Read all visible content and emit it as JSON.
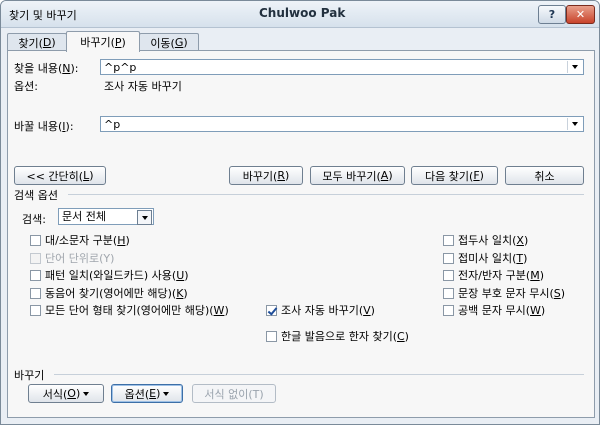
{
  "window": {
    "title_left": "찾기 및 바꾸기",
    "title_center": "Chulwoo Pak",
    "help_label": "?",
    "close_label": "✕"
  },
  "tabs": [
    {
      "label": "찾기(",
      "key": "D",
      "suffix": ")"
    },
    {
      "label": "바꾸기(",
      "key": "P",
      "suffix": ")"
    },
    {
      "label": "이동(",
      "key": "G",
      "suffix": ")"
    }
  ],
  "find": {
    "label": "찾을 내용(",
    "key": "N",
    "suffix": "):",
    "value": "^p^p"
  },
  "options_line": {
    "label": "옵션:",
    "value": "조사 자동 바꾸기"
  },
  "replace": {
    "label": "바꿀 내용(",
    "key": "I",
    "suffix": "):",
    "value": "^p"
  },
  "buttons": {
    "less": {
      "label": "<< 간단히(",
      "key": "L",
      "suffix": ")"
    },
    "replace": {
      "label": "바꾸기(",
      "key": "R",
      "suffix": ")"
    },
    "replace_all": {
      "label": "모두 바꾸기(",
      "key": "A",
      "suffix": ")"
    },
    "find_next": {
      "label": "다음 찾기(",
      "key": "F",
      "suffix": ")"
    },
    "cancel": {
      "label": "취소"
    }
  },
  "search_options": {
    "group_label": "검색 옵션",
    "search_label": "검색:",
    "search_value": "문서 전체"
  },
  "checkboxes_left": [
    {
      "label": "대/소문자 구분(",
      "key": "H",
      "suffix": ")",
      "checked": false,
      "disabled": false
    },
    {
      "label": "단어 단위로(Y)",
      "key": "",
      "suffix": "",
      "checked": false,
      "disabled": true
    },
    {
      "label": "패턴 일치(와일드카드) 사용(",
      "key": "U",
      "suffix": ")",
      "checked": false,
      "disabled": false
    },
    {
      "label": "동음어 찾기(영어에만 해당)(",
      "key": "K",
      "suffix": ")",
      "checked": false,
      "disabled": false
    },
    {
      "label": "모든 단어 형태 찾기(영어에만 해당)(",
      "key": "W",
      "suffix": ")",
      "checked": false,
      "disabled": false
    }
  ],
  "checkboxes_middle": [
    {
      "label": "조사 자동 바꾸기(",
      "key": "V",
      "suffix": ")",
      "checked": true,
      "disabled": false
    },
    {
      "label": "한글 발음으로 한자 찾기(",
      "key": "C",
      "suffix": ")",
      "checked": false,
      "disabled": false
    }
  ],
  "checkboxes_right": [
    {
      "label": "접두사 일치(",
      "key": "X",
      "suffix": ")",
      "checked": false,
      "disabled": false
    },
    {
      "label": "접미사 일치(",
      "key": "T",
      "suffix": ")",
      "checked": false,
      "disabled": false
    },
    {
      "label": "전자/반자 구분(",
      "key": "M",
      "suffix": ")",
      "checked": false,
      "disabled": false
    },
    {
      "label": "문장 부호 문자 무시(",
      "key": "S",
      "suffix": ")",
      "checked": false,
      "disabled": false
    },
    {
      "label": "공백 문자 무시(",
      "key": "W",
      "suffix": ")",
      "checked": false,
      "disabled": false
    }
  ],
  "replace_group": {
    "group_label": "바꾸기",
    "format": {
      "label": "서식(",
      "key": "O",
      "suffix": ")"
    },
    "special": {
      "label": "옵션(",
      "key": "E",
      "suffix": ")"
    },
    "no_format": {
      "label": "서식 없이(T)"
    }
  }
}
